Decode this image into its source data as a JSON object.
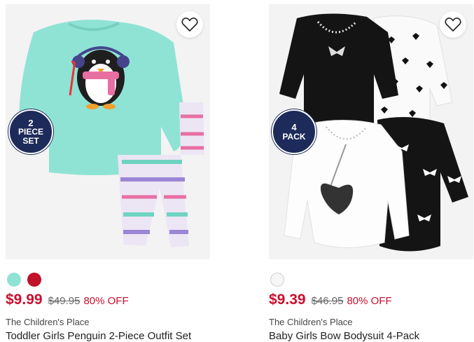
{
  "products": [
    {
      "badge_line1": "2",
      "badge_line2": "PIECE",
      "badge_line3": "SET",
      "swatches": [
        "#8fe3d5",
        "#c0102a"
      ],
      "price": "$9.99",
      "original_price": "$49.95",
      "discount": "80% OFF",
      "brand": "The Children's Place",
      "name": "Toddler Girls Penguin 2-Piece Outfit Set"
    },
    {
      "badge_line1": "4",
      "badge_line2": "PACK",
      "swatches": [
        "#f6f6f6"
      ],
      "price": "$9.39",
      "original_price": "$46.95",
      "discount": "80% OFF",
      "brand": "The Children's Place",
      "name": "Baby Girls Bow Bodysuit 4-Pack"
    }
  ],
  "icons": {
    "favorite": "heart-outline-icon"
  },
  "colors": {
    "price_red": "#c8102e",
    "badge_navy": "#1d2b5a",
    "image_bg": "#f3f3f3"
  }
}
